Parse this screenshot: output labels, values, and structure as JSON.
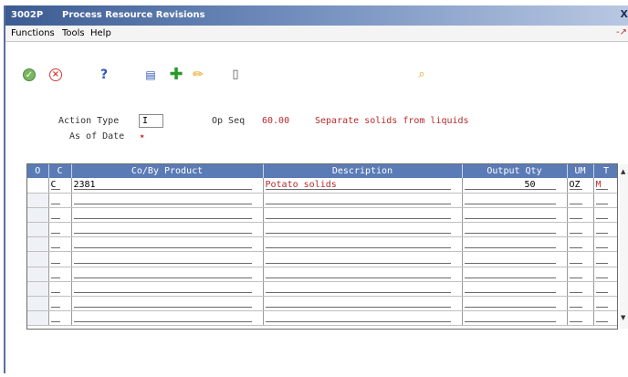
{
  "window": {
    "code": "3002P",
    "title": "Process Resource Revisions",
    "close_glyph": "X"
  },
  "menu": {
    "functions": "Functions",
    "tools": "Tools",
    "help": "Help",
    "corner": "-↗"
  },
  "toolbar": {
    "ok": "✓",
    "cancel": "×",
    "help": "?",
    "columns": "▤",
    "add": "✚",
    "edit": "✏",
    "delete": "▯",
    "find": "⌕"
  },
  "form": {
    "action_type_label": "Action Type",
    "action_type_value": "I",
    "as_of_date_label": "As of Date",
    "required_marker": "✶",
    "op_seq_label": "Op Seq",
    "op_seq_value": "60.00",
    "op_seq_desc": "Separate solids from liquids"
  },
  "grid": {
    "headers": [
      "O",
      "C",
      "Co/By Product",
      "Description",
      "Output Qty",
      "UM",
      "T"
    ],
    "rows": [
      [
        "",
        "C",
        "2381",
        "Potato solids",
        "50",
        "OZ",
        "M"
      ],
      [
        "",
        "",
        "",
        "",
        "",
        "",
        ""
      ],
      [
        "",
        "",
        "",
        "",
        "",
        "",
        ""
      ],
      [
        "",
        "",
        "",
        "",
        "",
        "",
        ""
      ],
      [
        "",
        "",
        "",
        "",
        "",
        "",
        ""
      ],
      [
        "",
        "",
        "",
        "",
        "",
        "",
        ""
      ],
      [
        "",
        "",
        "",
        "",
        "",
        "",
        ""
      ],
      [
        "",
        "",
        "",
        "",
        "",
        "",
        ""
      ],
      [
        "",
        "",
        "",
        "",
        "",
        "",
        ""
      ],
      [
        "",
        "",
        "",
        "",
        "",
        "",
        ""
      ]
    ]
  }
}
